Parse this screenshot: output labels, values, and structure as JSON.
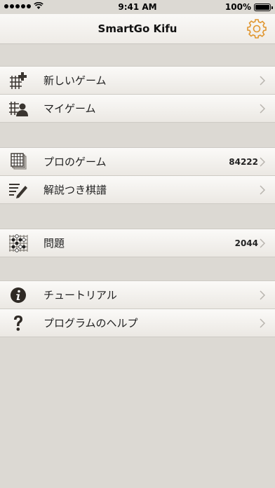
{
  "status_bar": {
    "time": "9:41 AM",
    "battery": "100%"
  },
  "nav": {
    "title": "SmartGo Kifu",
    "settings_icon": "gear-icon"
  },
  "sections": [
    {
      "items": [
        {
          "label": "新しいゲーム",
          "icon": "new-game-icon"
        },
        {
          "label": "マイゲーム",
          "icon": "my-games-icon"
        }
      ]
    },
    {
      "items": [
        {
          "label": "プロのゲーム",
          "icon": "pro-games-icon",
          "count": "84222"
        },
        {
          "label": "解説つき棋譜",
          "icon": "commentary-icon"
        }
      ]
    },
    {
      "items": [
        {
          "label": "問題",
          "icon": "problems-icon",
          "count": "2044"
        }
      ]
    },
    {
      "items": [
        {
          "label": "チュートリアル",
          "icon": "info-icon"
        },
        {
          "label": "プログラムのヘルプ",
          "icon": "help-icon"
        }
      ]
    }
  ],
  "colors": {
    "accent": "#e0962f",
    "background": "#dcd9d3",
    "icon": "#3a3530"
  }
}
